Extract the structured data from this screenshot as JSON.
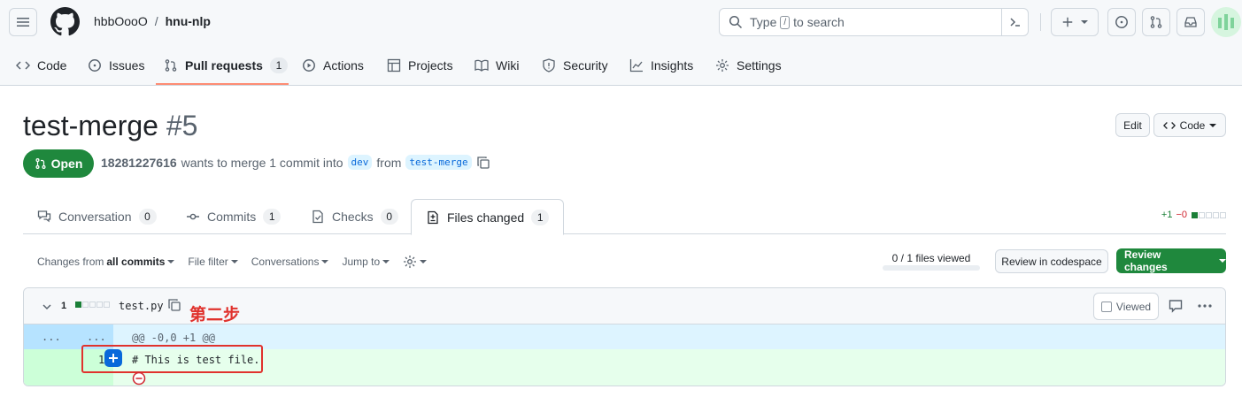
{
  "header": {
    "owner": "hbbOooO",
    "separator": "/",
    "repo": "hnu-nlp",
    "search": {
      "prefix": "Type",
      "key": "/",
      "suffix": "to search"
    }
  },
  "repo_tabs": [
    {
      "label": "Code",
      "icon": "code-icon"
    },
    {
      "label": "Issues",
      "icon": "issue-icon"
    },
    {
      "label": "Pull requests",
      "icon": "pull-request-icon",
      "count": "1",
      "active": true
    },
    {
      "label": "Actions",
      "icon": "play-icon"
    },
    {
      "label": "Projects",
      "icon": "table-icon"
    },
    {
      "label": "Wiki",
      "icon": "book-icon"
    },
    {
      "label": "Security",
      "icon": "shield-icon"
    },
    {
      "label": "Insights",
      "icon": "graph-icon"
    },
    {
      "label": "Settings",
      "icon": "gear-icon"
    }
  ],
  "pr": {
    "title": "test-merge",
    "number": "#5",
    "edit_label": "Edit",
    "code_label": "Code",
    "state": "Open",
    "author": "18281227616",
    "meta_text": "wants to merge 1 commit into",
    "base": "dev",
    "from_text": "from",
    "head": "test-merge"
  },
  "pr_tabs": [
    {
      "label": "Conversation",
      "count": "0",
      "icon": "comment-discussion-icon"
    },
    {
      "label": "Commits",
      "count": "1",
      "icon": "commit-icon"
    },
    {
      "label": "Checks",
      "count": "0",
      "icon": "checklist-icon"
    },
    {
      "label": "Files changed",
      "count": "1",
      "icon": "file-diff-icon",
      "active": true
    }
  ],
  "diffstat": {
    "additions": "+1",
    "deletions": "−0"
  },
  "toolbar": {
    "changes_from": "Changes from",
    "changes_value": "all commits",
    "file_filter": "File filter",
    "conversations": "Conversations",
    "jump_to": "Jump to",
    "viewed_count": "0 / 1 files viewed",
    "viewed_progress": 0,
    "codespace": "Review in codespace",
    "review": "Review changes"
  },
  "file": {
    "change_count": "1",
    "name": "test.py",
    "annotation": "第二步",
    "viewed_label": "Viewed",
    "hunk_left": "...",
    "hunk_right": "...",
    "hunk_header": "@@ -0,0 +1 @@",
    "line_number": "1",
    "code": "# This is test file."
  },
  "colors": {
    "accent_green": "#1f883d",
    "annotation_red": "#e0322d",
    "tab_underline": "#fd8c73",
    "add_bg": "#e6ffec",
    "hunk_bg": "#ddf4ff"
  }
}
